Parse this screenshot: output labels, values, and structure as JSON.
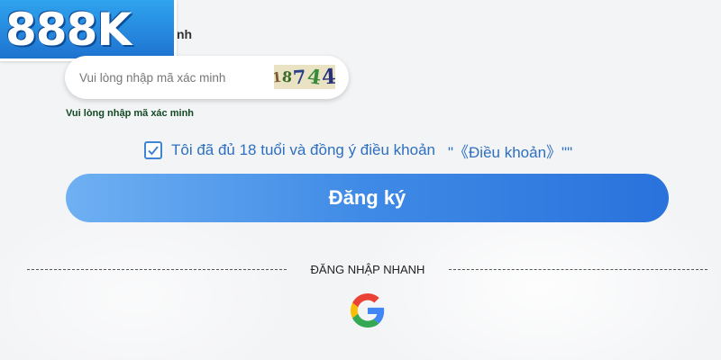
{
  "logo": {
    "text": "888K"
  },
  "form": {
    "partial_label": "nh",
    "captcha": {
      "placeholder": "Vui lòng nhập mã xác minh",
      "code": [
        "1",
        "8",
        "7",
        "4",
        "4"
      ],
      "hint": "Vui lòng nhập mã xác minh"
    },
    "agree": {
      "checked": true,
      "text": "Tôi đã đủ 18 tuổi và đồng ý điều khoản",
      "terms_link": "\"《Điều khoản》\"\""
    },
    "register_label": "Đăng ký"
  },
  "quick_login": {
    "label": "ĐĂNG NHẬP NHANH",
    "providers": [
      {
        "icon": "google-icon"
      }
    ]
  },
  "colors": {
    "accent": "#2e6fc0",
    "button_start": "#6fb0f2",
    "button_end": "#2a72dc",
    "hint": "#124a23"
  }
}
